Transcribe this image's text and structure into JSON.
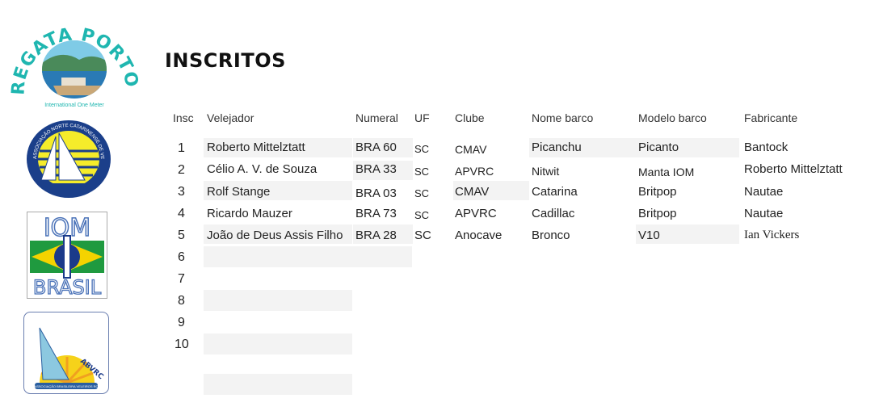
{
  "logos": {
    "regata_text": "REGATA PORTO BELO",
    "regata_sub": "International One Meter",
    "anc_text": "ASSOCIAÇÃO NORTE CATARINENSE DE VELEIROS RADIO CONTROLADOS",
    "iom_top": "IOM",
    "iom_bottom": "BRASIL",
    "abvrc_text": "ABVRC",
    "abvrc_sub": "ASSOCIAÇÃO BRASILEIRA VELEIROS RC"
  },
  "page": {
    "title": "INSCRITOS"
  },
  "table": {
    "headers": {
      "insc": "Insc",
      "velejador": "Velejador",
      "numeral": "Numeral",
      "uf": "UF",
      "clube": "Clube",
      "nome_barco": "Nome barco",
      "modelo_barco": "Modelo barco",
      "fabricante": "Fabricante"
    },
    "row_numbers": [
      "1",
      "2",
      "3",
      "4",
      "5",
      "6",
      "7",
      "8",
      "9",
      "10"
    ],
    "rows": [
      {
        "velejador": "Roberto Mittelztatt",
        "numeral": "BRA 60",
        "uf": "SC",
        "clube": "CMAV",
        "nome": "Picanchu",
        "modelo": "Picanto",
        "fabricante": "Bantock"
      },
      {
        "velejador": "Célio A. V. de Souza",
        "numeral": "BRA 33",
        "uf": "SC",
        "clube": "APVRC",
        "nome": "Nitwit",
        "modelo": "Manta IOM",
        "fabricante": "Roberto Mittelztatt"
      },
      {
        "velejador": "Rolf Stange",
        "numeral": "BRA 03",
        "uf": "SC",
        "clube": "CMAV",
        "nome": "Catarina",
        "modelo": "Britpop",
        "fabricante": "Nautae"
      },
      {
        "velejador": "Ricardo Mauzer",
        "numeral": "BRA 73",
        "uf": "SC",
        "clube": "APVRC",
        "nome": "Cadillac",
        "modelo": "Britpop",
        "fabricante": "Nautae"
      },
      {
        "velejador": "João de Deus Assis Filho",
        "numeral": "BRA 28",
        "uf": "SC",
        "clube": "Anocave",
        "nome": "Bronco",
        "modelo": "V10",
        "fabricante": "Ian Vickers"
      }
    ]
  }
}
